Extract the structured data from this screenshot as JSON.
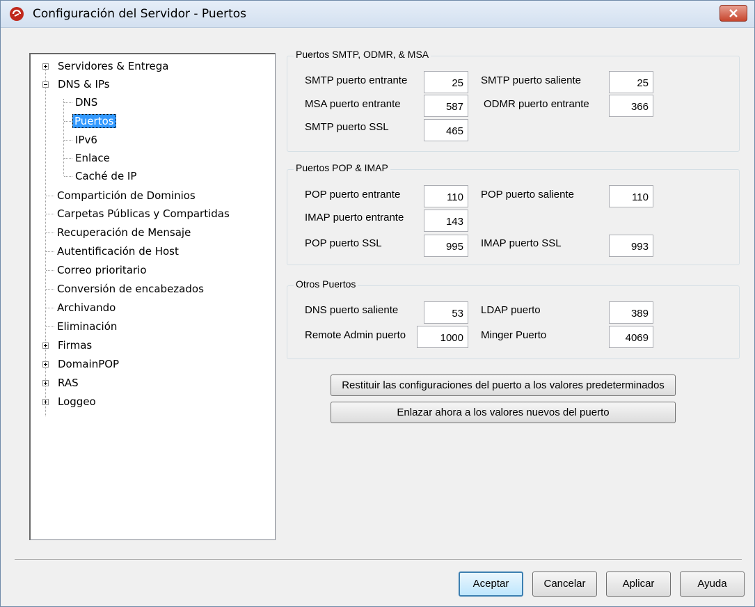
{
  "window": {
    "title": "Configuración del Servidor - Puertos",
    "accent": "#c7452d"
  },
  "tree": {
    "items": [
      {
        "label": "Servidores & Entrega"
      },
      {
        "label": "DNS & IPs"
      },
      {
        "label": "DNS"
      },
      {
        "label": "Puertos"
      },
      {
        "label": "IPv6"
      },
      {
        "label": "Enlace"
      },
      {
        "label": "Caché de IP"
      },
      {
        "label": "Compartición de Dominios"
      },
      {
        "label": "Carpetas Públicas y Compartidas"
      },
      {
        "label": "Recuperación de Mensaje"
      },
      {
        "label": "Autentificación de Host"
      },
      {
        "label": "Correo prioritario"
      },
      {
        "label": "Conversión de encabezados"
      },
      {
        "label": "Archivando"
      },
      {
        "label": "Eliminación"
      },
      {
        "label": "Firmas"
      },
      {
        "label": "DomainPOP"
      },
      {
        "label": "RAS"
      },
      {
        "label": "Loggeo"
      }
    ]
  },
  "smtp_group": {
    "title": "Puertos SMTP, ODMR, & MSA",
    "smtp_in_label": "SMTP puerto entrante",
    "smtp_in_value": "25",
    "smtp_out_label": "SMTP puerto saliente",
    "smtp_out_value": "25",
    "msa_in_label": "MSA puerto entrante",
    "msa_in_value": "587",
    "odmr_in_label": "ODMR puerto entrante",
    "odmr_in_value": "366",
    "smtp_ssl_label": "SMTP puerto SSL",
    "smtp_ssl_value": "465"
  },
  "pop_group": {
    "title": "Puertos POP & IMAP",
    "pop_in_label": "POP puerto entrante",
    "pop_in_value": "110",
    "pop_out_label": "POP puerto saliente",
    "pop_out_value": "110",
    "imap_in_label": "IMAP puerto entrante",
    "imap_in_value": "143",
    "pop_ssl_label": "POP puerto SSL",
    "pop_ssl_value": "995",
    "imap_ssl_label": "IMAP puerto SSL",
    "imap_ssl_value": "993"
  },
  "other_group": {
    "title": "Otros Puertos",
    "dns_out_label": "DNS puerto saliente",
    "dns_out_value": "53",
    "ldap_label": "LDAP puerto",
    "ldap_value": "389",
    "remote_admin_label": "Remote Admin puerto",
    "remote_admin_value": "1000",
    "minger_label": "Minger Puerto",
    "minger_value": "4069"
  },
  "actions": {
    "restore_label": "Restituir las configuraciones del puerto a los valores predeterminados",
    "bind_label": "Enlazar ahora a los valores nuevos del puerto"
  },
  "footer": {
    "ok": "Aceptar",
    "cancel": "Cancelar",
    "apply": "Aplicar",
    "help": "Ayuda"
  }
}
